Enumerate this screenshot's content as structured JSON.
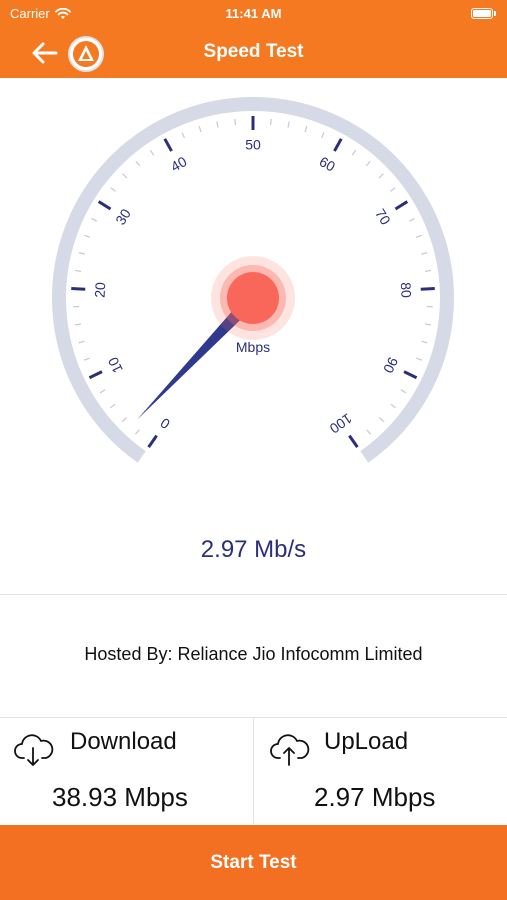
{
  "status_bar": {
    "carrier": "Carrier",
    "time": "11:41 AM"
  },
  "nav": {
    "title": "Speed Test",
    "back_icon": "arrow-left-icon",
    "logo_icon": "app-logo-icon"
  },
  "gauge": {
    "min": 0,
    "max": 100,
    "value": 2.97,
    "unit": "Mbps",
    "tick_labels": [
      "0",
      "10",
      "20",
      "30",
      "40",
      "50",
      "60",
      "70",
      "80",
      "90",
      "100"
    ],
    "colors": {
      "arc": "#d6d9e6",
      "ticks": "#2b2f7a",
      "needle": "#2f3a8f",
      "hub": "#f9675a"
    }
  },
  "speed_readout": "2.97 Mb/s",
  "hosted_by": "Hosted By: Reliance Jio Infocomm Limited",
  "download": {
    "label": "Download",
    "value": "38.93 Mbps",
    "icon": "cloud-download-icon"
  },
  "upload": {
    "label": "UpLoad",
    "value": "2.97 Mbps",
    "icon": "cloud-upload-icon"
  },
  "start_button": {
    "label": "Start Test"
  },
  "theme": {
    "accent": "#F47920",
    "text_dark": "#2b2f7a"
  }
}
